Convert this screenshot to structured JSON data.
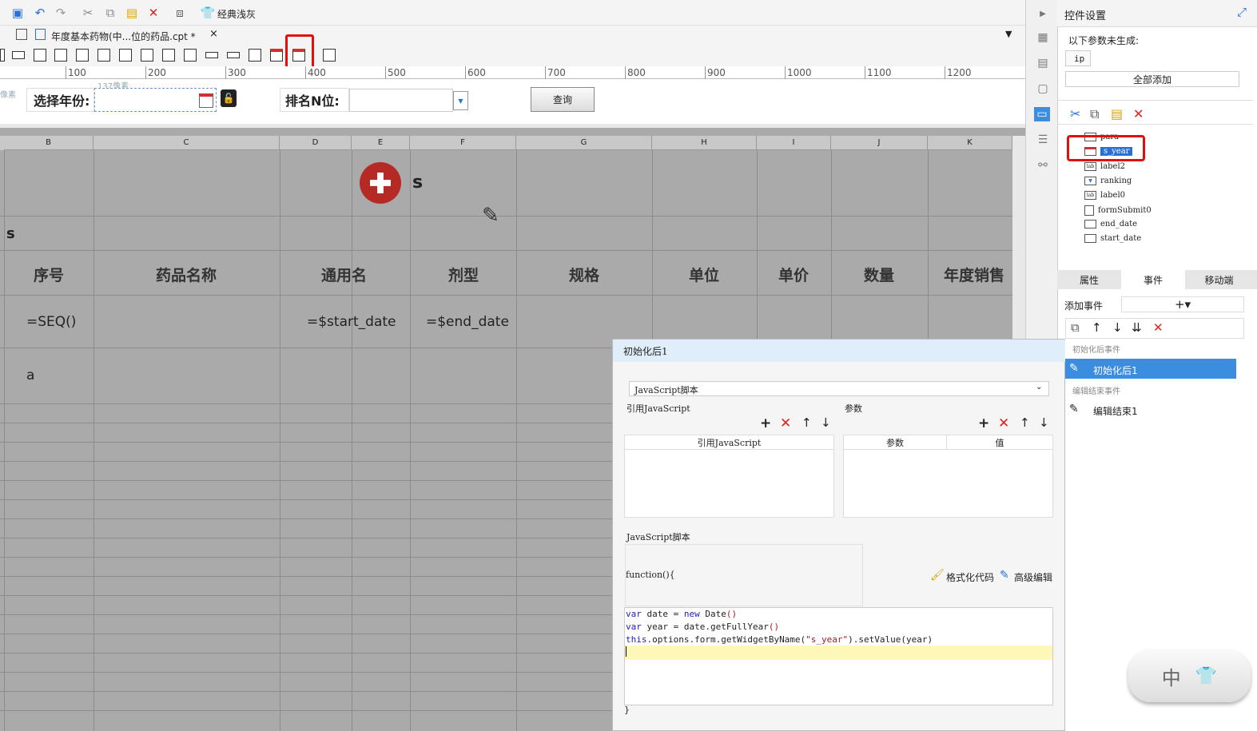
{
  "toolbar": {
    "theme_label": "经典浅灰"
  },
  "tab": {
    "title": "年度基本药物(中...位的药品.cpt *"
  },
  "ruler": {
    "ticks": [
      "100",
      "200",
      "300",
      "400",
      "500",
      "600",
      "700",
      "800",
      "900",
      "1000",
      "1100",
      "1200"
    ]
  },
  "param_panel": {
    "size_tip": "137像素",
    "side_tip": "像素",
    "year_label": "选择年份:",
    "rank_label": "排名N位:",
    "query_button": "查询"
  },
  "grid": {
    "columns": [
      "B",
      "C",
      "D",
      "E",
      "F",
      "G",
      "H",
      "I",
      "J",
      "K"
    ],
    "title_text": "s",
    "row2_text": "s",
    "headers": [
      "序号",
      "药品名称",
      "通用名",
      "剂型",
      "规格",
      "单位",
      "单价",
      "数量",
      "年度销售"
    ],
    "row4": {
      "seq": "=SEQ()",
      "start": "=$start_date",
      "end": "=$end_date"
    },
    "row5_text": "a"
  },
  "control_settings": {
    "title": "控件设置",
    "missing_params_label": "以下参数未生成:",
    "missing_param": "ip",
    "add_all_button": "全部添加",
    "tree": [
      "para",
      "s_year",
      "label2",
      "ranking",
      "label0",
      "formSubmit0",
      "end_date",
      "start_date"
    ],
    "tabs": [
      "属性",
      "事件",
      "移动端"
    ],
    "add_event_label": "添加事件",
    "event_group_init": "初始化后事件",
    "event_init": "初始化后1",
    "event_group_edit": "编辑结束事件",
    "event_edit": "编辑结束1"
  },
  "dialog": {
    "title": "初始化后1",
    "script_type": "JavaScript脚本",
    "ref_js_label": "引用JavaScript",
    "params_label": "参数",
    "ref_js_col": "引用JavaScript",
    "param_col": "参数",
    "value_col": "值",
    "js_section_label": "JavaScript脚本",
    "func_open": "function(){",
    "format_code": "格式化代码",
    "advanced_edit": "高级编辑",
    "code_line1_kw": "var",
    "code_line1": " date = ",
    "code_line1_new": "new",
    "code_line1_end": " Date",
    "code_line2_kw": "var",
    "code_line2": " year = date.getFullYear",
    "code_line3_kw": "this",
    "code_line3": ".options.form.getWidgetByName(",
    "code_line3_str": "\"s_year\"",
    "code_line3_end": ").setValue(year)",
    "func_close": "}"
  },
  "ime": {
    "label": "中"
  }
}
